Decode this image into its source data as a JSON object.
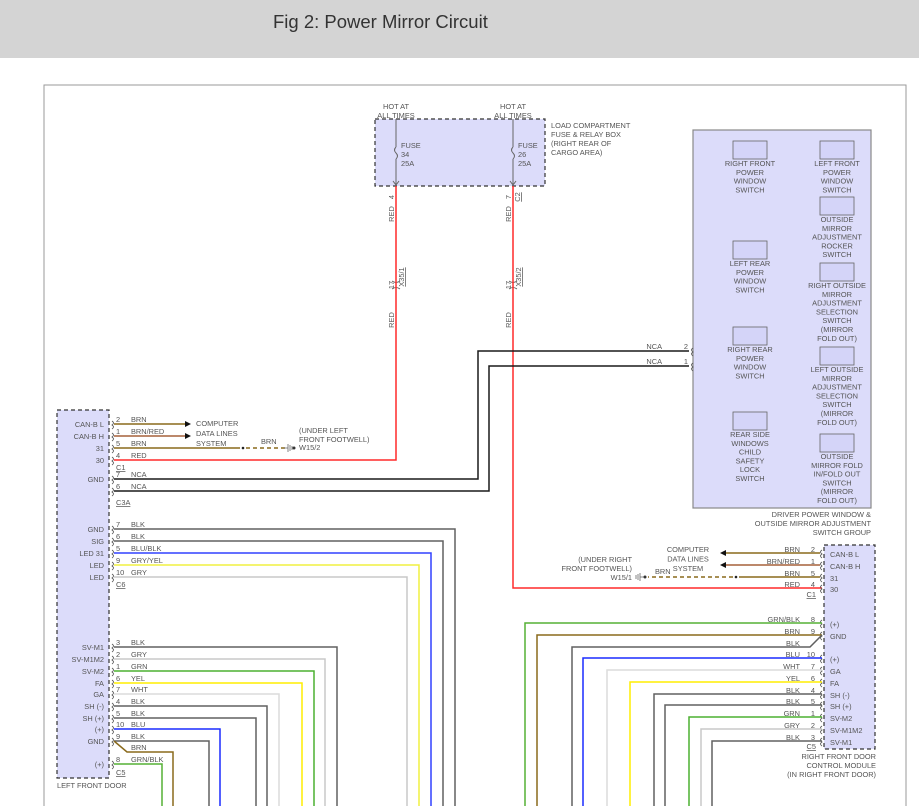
{
  "title": "Fig 2: Power Mirror Circuit",
  "fuse_box": {
    "hot_label": [
      "HOT AT",
      "ALL TIMES"
    ],
    "label": [
      "LOAD COMPARTMENT",
      "FUSE & RELAY BOX",
      "(RIGHT REAR OF",
      "CARGO AREA)"
    ],
    "fuses": [
      {
        "name": "FUSE",
        "number": "34",
        "rating": "25A",
        "pin": "4",
        "connector": "",
        "wire": "RED",
        "inline_pin": "17",
        "inline_connector": "X35/1"
      },
      {
        "name": "FUSE",
        "number": "26",
        "rating": "25A",
        "pin": "7",
        "connector": "C2",
        "wire": "RED",
        "inline_pin": "17",
        "inline_connector": "X35/2"
      }
    ]
  },
  "switch_group": {
    "label": [
      "DRIVER POWER WINDOW &",
      "OUTSIDE MIRROR ADJUSTMENT",
      "SWITCH GROUP"
    ],
    "pins": [
      {
        "pin": "2",
        "wire": "NCA"
      },
      {
        "pin": "1",
        "wire": "NCA"
      }
    ],
    "switches_left": [
      [
        "RIGHT FRONT",
        "POWER",
        "WINDOW",
        "SWITCH"
      ],
      [
        "LEFT REAR",
        "POWER",
        "WINDOW",
        "SWITCH"
      ],
      [
        "RIGHT REAR",
        "POWER",
        "WINDOW",
        "SWITCH"
      ],
      [
        "REAR SIDE",
        "WINDOWS",
        "CHILD",
        "SAFETY",
        "LOCK",
        "SWITCH"
      ]
    ],
    "switches_right": [
      [
        "LEFT FRONT",
        "POWER",
        "WINDOW",
        "SWITCH"
      ],
      [
        "OUTSIDE",
        "MIRROR",
        "ADJUSTMENT",
        "ROCKER",
        "SWITCH"
      ],
      [
        "RIGHT OUTSIDE",
        "MIRROR",
        "ADJUSTMENT",
        "SELECTION",
        "SWITCH",
        "(MIRROR",
        "FOLD OUT)"
      ],
      [
        "LEFT OUTSIDE",
        "MIRROR",
        "ADJUSTMENT",
        "SELECTION",
        "SWITCH",
        "(MIRROR",
        "FOLD OUT)"
      ],
      [
        "OUTSIDE",
        "MIRROR FOLD",
        "IN/FOLD OUT",
        "SWITCH",
        "(MIRROR",
        "FOLD OUT)"
      ]
    ]
  },
  "computer_data_lines": [
    "COMPUTER",
    "DATA LINES",
    "SYSTEM"
  ],
  "left_ground": {
    "location": [
      "(UNDER LEFT",
      "FRONT FOOTWELL)"
    ],
    "wire": "BRN",
    "id": "W15/2"
  },
  "right_ground": {
    "location": [
      "(UNDER RIGHT",
      "FRONT FOOTWELL)"
    ],
    "wire": "BRN",
    "id": "W15/1"
  },
  "left_module": {
    "label": "LEFT FRONT DOOR",
    "connectors": [
      {
        "name": "C1",
        "pins": [
          {
            "func": "CAN-B L",
            "pin": "2",
            "wire": "BRN"
          },
          {
            "func": "CAN-B H",
            "pin": "1",
            "wire": "BRN/RED"
          },
          {
            "func": "31",
            "pin": "5",
            "wire": "BRN"
          },
          {
            "func": "30",
            "pin": "4",
            "wire": "RED"
          }
        ]
      },
      {
        "name": "C3A",
        "pins": [
          {
            "func": "GND",
            "pin": "7",
            "wire": "NCA"
          },
          {
            "func": "",
            "pin": "6",
            "wire": "NCA"
          }
        ]
      },
      {
        "name": "C6",
        "pins": [
          {
            "func": "GND",
            "pin": "7",
            "wire": "BLK"
          },
          {
            "func": "SIG",
            "pin": "6",
            "wire": "BLK"
          },
          {
            "func": "LED 31",
            "pin": "5",
            "wire": "BLU/BLK"
          },
          {
            "func": "LED",
            "pin": "9",
            "wire": "GRY/YEL"
          },
          {
            "func": "LED",
            "pin": "10",
            "wire": "GRY"
          }
        ]
      },
      {
        "name": "C5",
        "pins": [
          {
            "func": "SV-M1",
            "pin": "3",
            "wire": "BLK"
          },
          {
            "func": "SV-M1M2",
            "pin": "2",
            "wire": "GRY"
          },
          {
            "func": "SV-M2",
            "pin": "1",
            "wire": "GRN"
          },
          {
            "func": "FA",
            "pin": "6",
            "wire": "YEL"
          },
          {
            "func": "GA",
            "pin": "7",
            "wire": "WHT"
          },
          {
            "func": "SH (-)",
            "pin": "4",
            "wire": "BLK"
          },
          {
            "func": "SH (+)",
            "pin": "5",
            "wire": "BLK"
          },
          {
            "func": "(+)",
            "pin": "10",
            "wire": "BLU"
          },
          {
            "func": "GND",
            "pin": "9",
            "wire": "BLK"
          },
          {
            "func": "",
            "pin": "",
            "wire": "BRN"
          },
          {
            "func": "(+)",
            "pin": "8",
            "wire": "GRN/BLK"
          }
        ]
      }
    ]
  },
  "right_module": {
    "label": [
      "RIGHT FRONT DOOR",
      "CONTROL MODULE",
      "(IN RIGHT FRONT DOOR)"
    ],
    "connectors": [
      {
        "name": "C1",
        "pins": [
          {
            "func": "CAN-B L",
            "pin": "2",
            "wire": "BRN"
          },
          {
            "func": "CAN-B H",
            "pin": "1",
            "wire": "BRN/RED"
          },
          {
            "func": "31",
            "pin": "5",
            "wire": "BRN"
          },
          {
            "func": "30",
            "pin": "4",
            "wire": "RED"
          }
        ]
      },
      {
        "name": "C5",
        "pins": [
          {
            "func": "(+)",
            "pin": "8",
            "wire": "GRN/BLK"
          },
          {
            "func": "GND",
            "pin": "9",
            "wire": "BRN"
          },
          {
            "func": "",
            "pin": "",
            "wire": "BLK"
          },
          {
            "func": "(+)",
            "pin": "10",
            "wire": "BLU"
          },
          {
            "func": "GA",
            "pin": "7",
            "wire": "WHT"
          },
          {
            "func": "FA",
            "pin": "6",
            "wire": "YEL"
          },
          {
            "func": "SH (-)",
            "pin": "4",
            "wire": "BLK"
          },
          {
            "func": "SH (+)",
            "pin": "5",
            "wire": "BLK"
          },
          {
            "func": "SV-M2",
            "pin": "1",
            "wire": "GRN"
          },
          {
            "func": "SV-M1M2",
            "pin": "2",
            "wire": "GRY"
          },
          {
            "func": "SV-M1",
            "pin": "3",
            "wire": "BLK"
          }
        ]
      }
    ]
  },
  "wire_colors": {
    "BRN": "#8a6a1c",
    "BRN/RED": "#a5603a",
    "RED": "#ff2a2a",
    "NCA": "#1a1a1a",
    "BLK": "#606060",
    "BLU/BLK": "#3040ff",
    "GRY/YEL": "#f0f040",
    "GRY": "#c8c8c8",
    "GRN": "#4cb030",
    "YEL": "#ffee00",
    "WHT": "#dcdcdc",
    "BLU": "#1a2cff",
    "GRN/BLK": "#55b035"
  },
  "module_fill": "#dcdcfa"
}
